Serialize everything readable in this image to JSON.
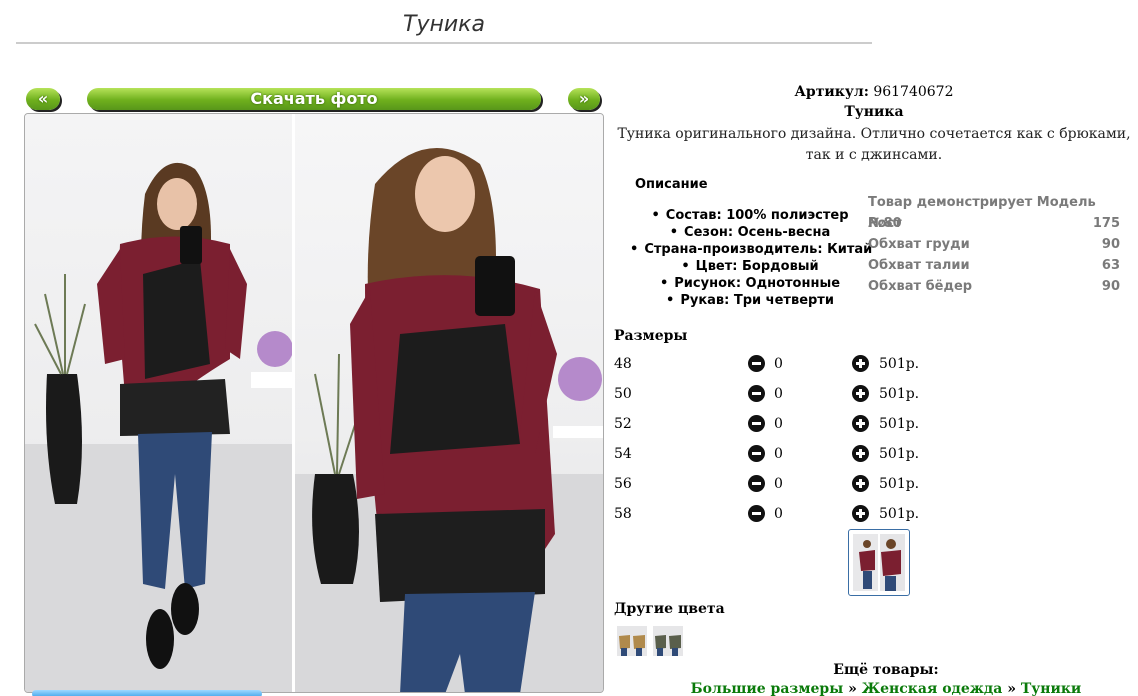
{
  "page": {
    "title": "Туника"
  },
  "gallery": {
    "prev_label": "«",
    "download_label": "Скачать фото",
    "next_label": "»"
  },
  "product": {
    "article_label": "Артикул:",
    "article_value": "961740672",
    "name": "Туника",
    "description": "Туника оригинального дизайна. Отлично сочетается как с брюками, так и с джинсами."
  },
  "specs": {
    "heading": "Описание",
    "items": [
      "Состав: 100% полиэстер",
      "Сезон: Осень-весна",
      "Страна-производитель: Китай",
      "Цвет: Бордовый",
      "Рисунок: Однотонные",
      "Рукав: Три четверти"
    ]
  },
  "model": {
    "title": "Товар демонстрирует Модель №80",
    "rows": [
      {
        "label": "Рост",
        "value": "175"
      },
      {
        "label": "Обхват груди",
        "value": "90"
      },
      {
        "label": "Обхват талии",
        "value": "63"
      },
      {
        "label": "Обхват бёдер",
        "value": "90"
      }
    ]
  },
  "sizes": {
    "heading": "Размеры",
    "rows": [
      {
        "size": "48",
        "qty": "0",
        "price": "501р."
      },
      {
        "size": "50",
        "qty": "0",
        "price": "501р."
      },
      {
        "size": "52",
        "qty": "0",
        "price": "501р."
      },
      {
        "size": "54",
        "qty": "0",
        "price": "501р."
      },
      {
        "size": "56",
        "qty": "0",
        "price": "501р."
      },
      {
        "size": "58",
        "qty": "0",
        "price": "501р."
      }
    ]
  },
  "other_colors": {
    "heading": "Другие цвета"
  },
  "more": {
    "heading": "Ещё товары:",
    "crumbs": [
      "Большие размеры",
      "Женская одежда",
      "Туники"
    ],
    "separator": "»"
  },
  "colors": {
    "accent_green": "#6fb01d",
    "tunic_burgundy": "#7b1f30",
    "link_green": "#0a7a0a"
  }
}
